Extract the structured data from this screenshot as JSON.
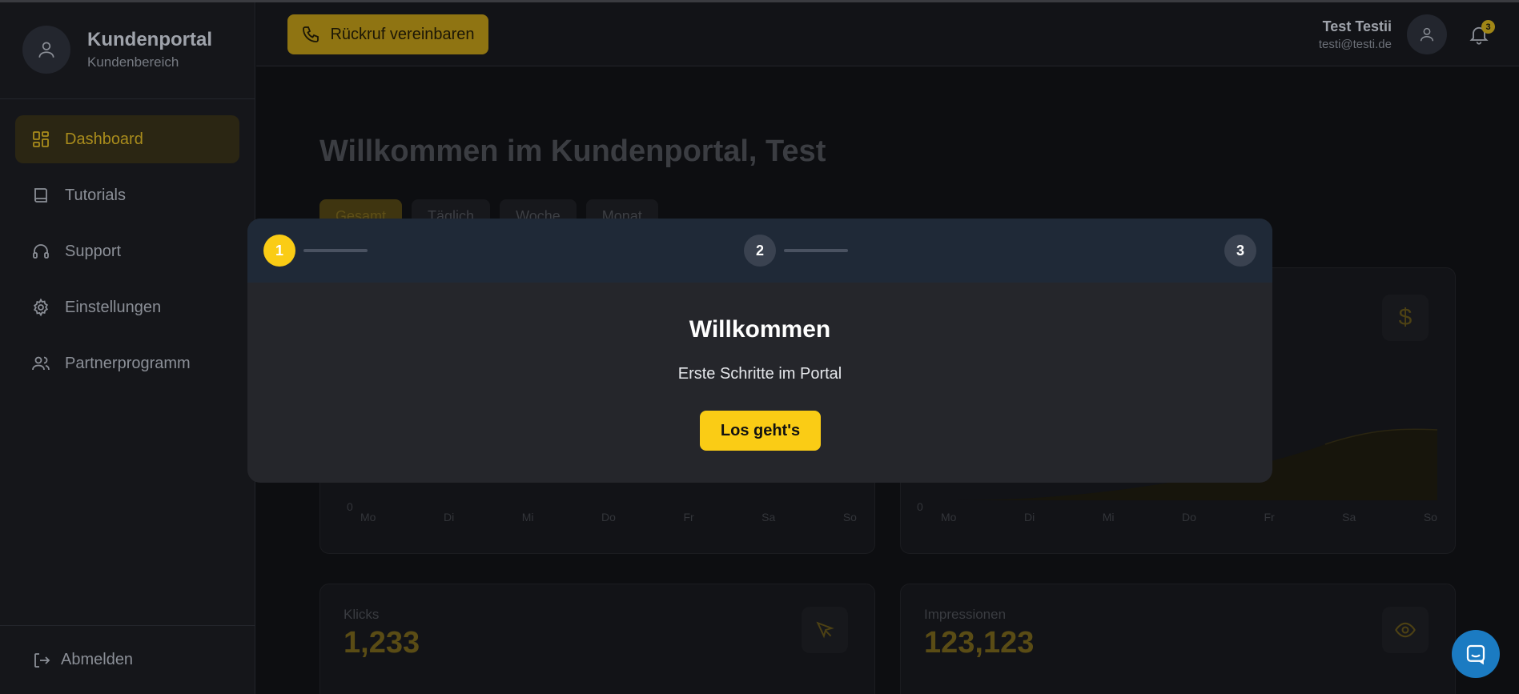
{
  "brand": {
    "title": "Kundenportal",
    "subtitle": "Kundenbereich"
  },
  "sidebar": {
    "items": [
      {
        "label": "Dashboard",
        "icon": "dashboard-grid-icon",
        "active": true
      },
      {
        "label": "Tutorials",
        "icon": "book-icon",
        "active": false
      },
      {
        "label": "Support",
        "icon": "headphones-icon",
        "active": false
      },
      {
        "label": "Einstellungen",
        "icon": "gear-icon",
        "active": false
      },
      {
        "label": "Partnerprogramm",
        "icon": "users-icon",
        "active": false
      }
    ],
    "logout_label": "Abmelden"
  },
  "header": {
    "callback_label": "Rückruf vereinbaren",
    "user_name": "Test Testii",
    "user_email": "testi@testi.de",
    "notification_count": "3"
  },
  "main": {
    "title": "Willkommen im Kundenportal, Test",
    "tabs": [
      "Gesamt",
      "Täglich",
      "Woche",
      "Monat"
    ],
    "active_tab": "Gesamt",
    "chart_days": [
      "Mo",
      "Di",
      "Mi",
      "Do",
      "Fr",
      "Sa",
      "So"
    ],
    "chart_zero": "0",
    "stats": [
      {
        "label": "Klicks",
        "value": "1,233",
        "icon": "cursor-icon"
      },
      {
        "label": "Impressionen",
        "value": "123,123",
        "icon": "eye-icon"
      }
    ],
    "currency_icon": "dollar-icon"
  },
  "modal": {
    "steps": [
      "1",
      "2",
      "3"
    ],
    "current_step": 1,
    "title": "Willkommen",
    "subtitle": "Erste Schritte im Portal",
    "button_label": "Los geht's"
  },
  "colors": {
    "accent": "#facc15",
    "modal_header": "#1f2937",
    "modal_body": "#25262b",
    "chat": "#1b7bc2"
  }
}
